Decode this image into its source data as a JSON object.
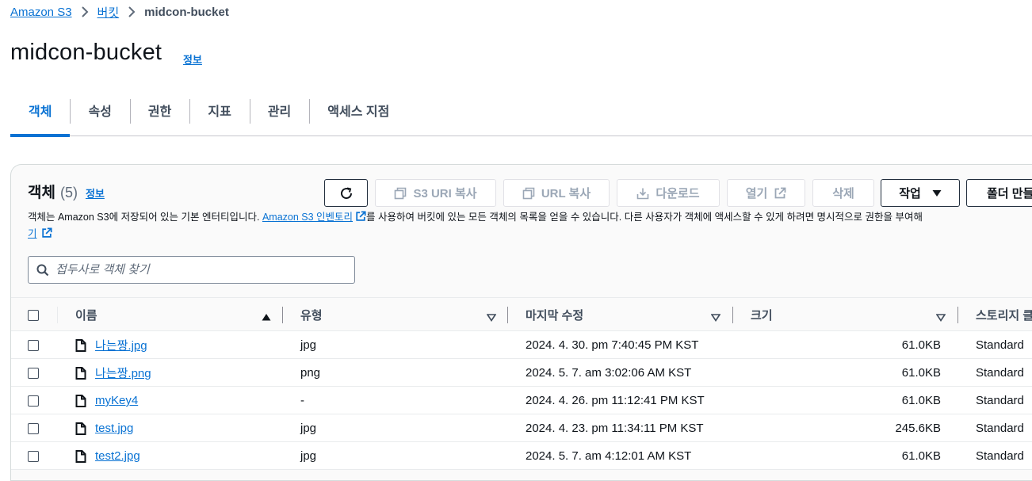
{
  "breadcrumb": {
    "root": "Amazon S3",
    "buckets": "버킷",
    "current": "midcon-bucket"
  },
  "page": {
    "title": "midcon-bucket",
    "info": "정보"
  },
  "tabs": [
    {
      "label": "객체",
      "active": true
    },
    {
      "label": "속성"
    },
    {
      "label": "권한"
    },
    {
      "label": "지표"
    },
    {
      "label": "관리"
    },
    {
      "label": "액세스 지점"
    }
  ],
  "objects_panel": {
    "title": "객체",
    "count": "(5)",
    "info": "정보",
    "buttons": {
      "copy_s3_uri": "S3 URI 복사",
      "copy_url": "URL 복사",
      "download": "다운로드",
      "open": "열기",
      "delete": "삭제",
      "actions": "작업",
      "create_folder": "폴더 만들"
    },
    "description_pre": "객체는 Amazon S3에 저장되어 있는 기본 엔터티입니다. ",
    "description_link": "Amazon S3 인벤토리",
    "description_post": "를 사용하여 버킷에 있는 모든 객체의 목록을 얻을 수 있습니다. 다른 사용자가 객체에 액세스할 수 있게 하려면 명시적으로 권한을 부여해",
    "description_link2": "기",
    "search_placeholder": "접두사로 객체 찾기"
  },
  "table": {
    "columns": {
      "name": "이름",
      "type": "유형",
      "modified": "마지막 수정",
      "size": "크기",
      "storage": "스토리지 클"
    },
    "rows": [
      {
        "name": "나는짱.jpg",
        "type": "jpg",
        "modified": "2024. 4. 30. pm 7:40:45 PM KST",
        "size": "61.0KB",
        "storage": "Standard"
      },
      {
        "name": "나는짱.png",
        "type": "png",
        "modified": "2024. 5. 7. am 3:02:06 AM KST",
        "size": "61.0KB",
        "storage": "Standard"
      },
      {
        "name": "myKey4",
        "type": "-",
        "modified": "2024. 4. 26. pm 11:12:41 PM KST",
        "size": "61.0KB",
        "storage": "Standard"
      },
      {
        "name": "test.jpg",
        "type": "jpg",
        "modified": "2024. 4. 23. pm 11:34:11 PM KST",
        "size": "245.6KB",
        "storage": "Standard"
      },
      {
        "name": "test2.jpg",
        "type": "jpg",
        "modified": "2024. 5. 7. am 4:12:01 AM KST",
        "size": "61.0KB",
        "storage": "Standard"
      }
    ]
  },
  "colors": {
    "link": "#0972d3",
    "text": "#0f141a",
    "muted": "#414d5c",
    "disabled": "#9ba7b6"
  }
}
